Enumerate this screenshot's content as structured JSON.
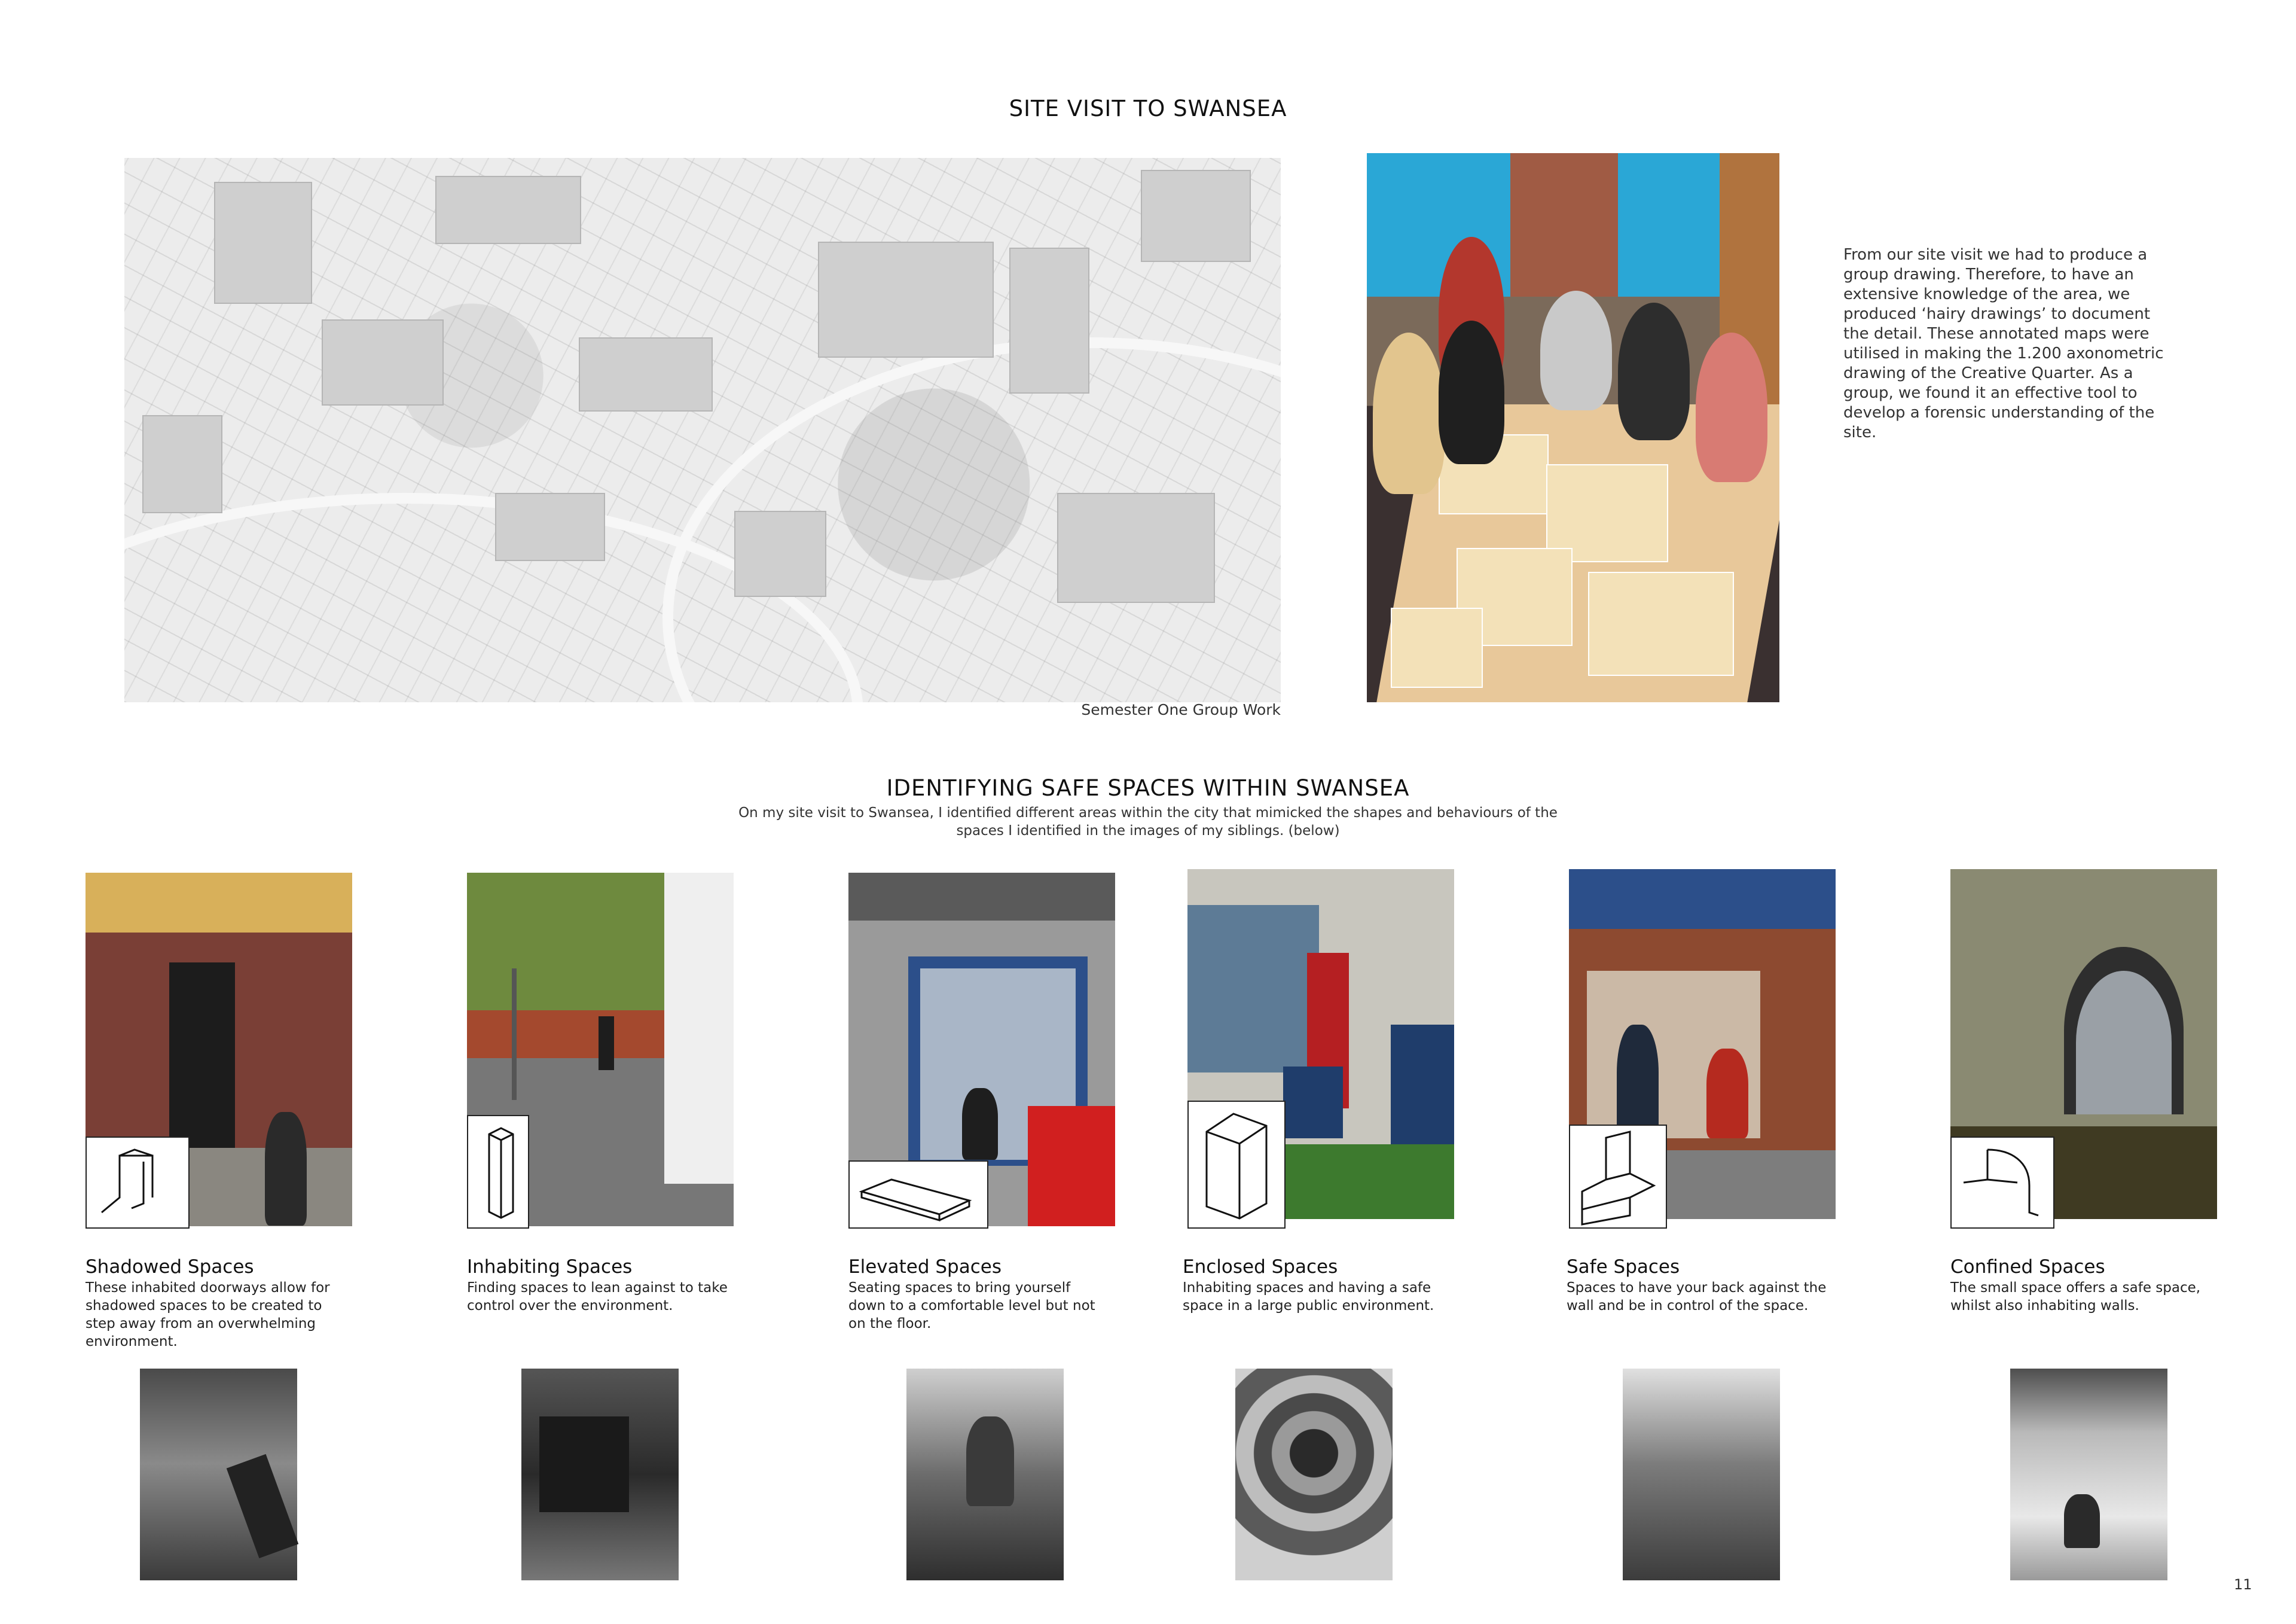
{
  "site_visit": {
    "title": "SITE VISIT TO SWANSEA",
    "map_caption": "Semester One Group Work",
    "description": "From our site visit we had to produce a group drawing. Therefore, to have an extensive knowledge of the area, we produced ‘hairy drawings’ to document the detail. These annotated maps were utilised in making the 1.200 axonometric drawing of the Creative Quarter. As a group, we found it an effective tool to develop a forensic understanding of the site."
  },
  "safe_spaces": {
    "title": "IDENTIFYING SAFE SPACES WITHIN SWANSEA",
    "intro_line1": "On my site visit to Swansea, I identified different areas within the city that mimicked the shapes and behaviours of the",
    "intro_line2": "spaces I identified in the images of my siblings. (below)",
    "items": [
      {
        "title": "Shadowed Spaces",
        "description": "These inhabited doorways allow for shadowed spaces to be created to step away from an overwhelming environment."
      },
      {
        "title": "Inhabiting Spaces",
        "description": "Finding spaces to lean against to take control over the environment."
      },
      {
        "title": "Elevated Spaces",
        "description": "Seating spaces to bring yourself down to a comfortable level but not on the floor."
      },
      {
        "title": "Enclosed Spaces",
        "description": "Inhabiting spaces and having a safe space in a large public environment."
      },
      {
        "title": "Safe Spaces",
        "description": "Spaces to have your back against the wall and be in control of the space."
      },
      {
        "title": "Confined Spaces",
        "description": "The small space offers a safe space, whilst also inhabiting walls."
      }
    ]
  },
  "page_number": "11"
}
